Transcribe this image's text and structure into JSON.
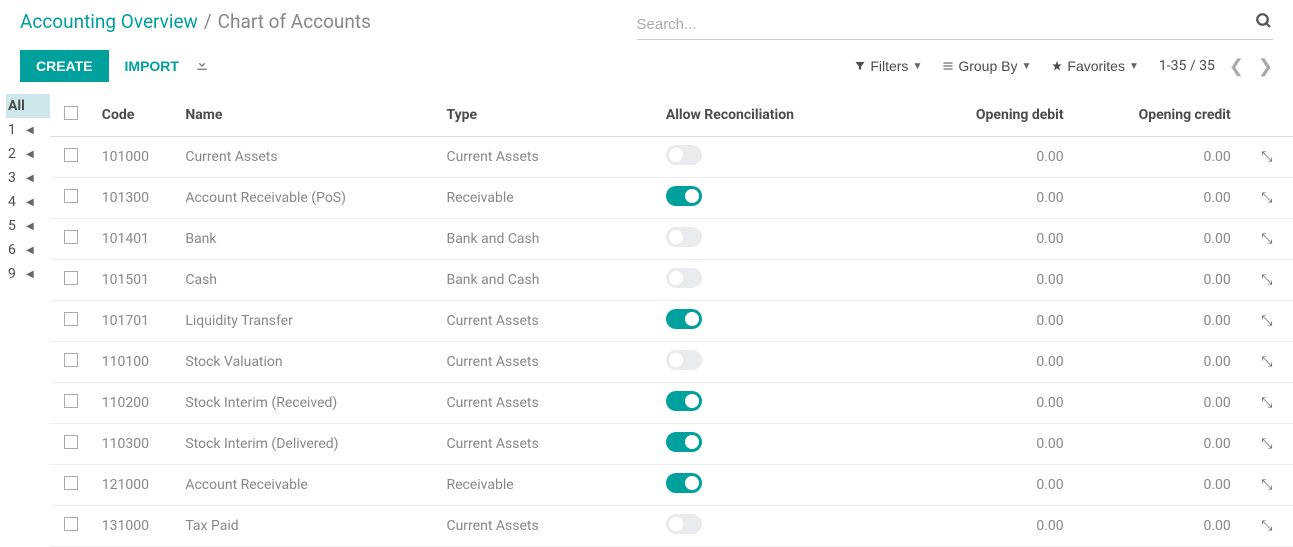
{
  "breadcrumb": {
    "root": "Accounting Overview",
    "current": "Chart of Accounts"
  },
  "search": {
    "placeholder": "Search..."
  },
  "toolbar": {
    "create": "CREATE",
    "import": "IMPORT"
  },
  "filters": {
    "filters": "Filters",
    "groupby": "Group By",
    "favorites": "Favorites"
  },
  "pager": {
    "range": "1-35 / 35"
  },
  "letters": [
    "All",
    "1",
    "2",
    "3",
    "4",
    "5",
    "6",
    "9"
  ],
  "headers": {
    "code": "Code",
    "name": "Name",
    "type": "Type",
    "recon": "Allow Reconciliation",
    "debit": "Opening debit",
    "credit": "Opening credit"
  },
  "rows": [
    {
      "code": "101000",
      "name": "Current Assets",
      "type": "Current Assets",
      "recon": false,
      "debit": "0.00",
      "credit": "0.00"
    },
    {
      "code": "101300",
      "name": "Account Receivable (PoS)",
      "type": "Receivable",
      "recon": true,
      "debit": "0.00",
      "credit": "0.00"
    },
    {
      "code": "101401",
      "name": "Bank",
      "type": "Bank and Cash",
      "recon": false,
      "debit": "0.00",
      "credit": "0.00"
    },
    {
      "code": "101501",
      "name": "Cash",
      "type": "Bank and Cash",
      "recon": false,
      "debit": "0.00",
      "credit": "0.00"
    },
    {
      "code": "101701",
      "name": "Liquidity Transfer",
      "type": "Current Assets",
      "recon": true,
      "debit": "0.00",
      "credit": "0.00"
    },
    {
      "code": "110100",
      "name": "Stock Valuation",
      "type": "Current Assets",
      "recon": false,
      "debit": "0.00",
      "credit": "0.00"
    },
    {
      "code": "110200",
      "name": "Stock Interim (Received)",
      "type": "Current Assets",
      "recon": true,
      "debit": "0.00",
      "credit": "0.00"
    },
    {
      "code": "110300",
      "name": "Stock Interim (Delivered)",
      "type": "Current Assets",
      "recon": true,
      "debit": "0.00",
      "credit": "0.00"
    },
    {
      "code": "121000",
      "name": "Account Receivable",
      "type": "Receivable",
      "recon": true,
      "debit": "0.00",
      "credit": "0.00"
    },
    {
      "code": "131000",
      "name": "Tax Paid",
      "type": "Current Assets",
      "recon": false,
      "debit": "0.00",
      "credit": "0.00"
    }
  ]
}
